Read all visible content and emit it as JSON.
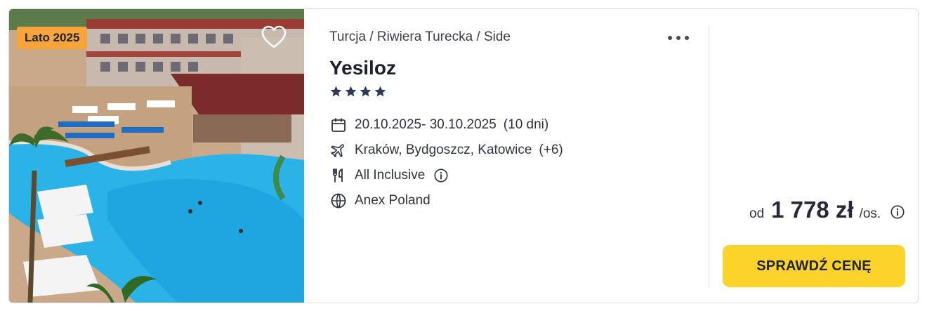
{
  "offer": {
    "season_badge": "Lato 2025",
    "breadcrumb": "Turcja / Riwiera Turecka / Side",
    "hotel_name": "Yesiloz",
    "star_rating": 4,
    "dates": "20.10.2025- 30.10.2025",
    "duration": "(10 dni)",
    "departure_airports": "Kraków, Bydgoszcz, Katowice",
    "more_airports": "(+6)",
    "board": "All Inclusive",
    "operator": "Anex Poland",
    "price": {
      "prefix": "od",
      "amount": "1 778 zł",
      "unit": "/os."
    },
    "cta_label": "SPRAWDŹ CENĘ"
  },
  "icons": {
    "favorite": "heart-outline-icon",
    "more": "more-dots-icon",
    "star": "star-icon",
    "calendar": "calendar-icon",
    "flight": "airplane-icon",
    "board": "cutlery-icon",
    "operator": "globe-icon",
    "info": "info-circle-icon"
  },
  "colors": {
    "badge": "#f8a43c",
    "cta": "#fcd32a",
    "text": "#2c2f3a"
  }
}
